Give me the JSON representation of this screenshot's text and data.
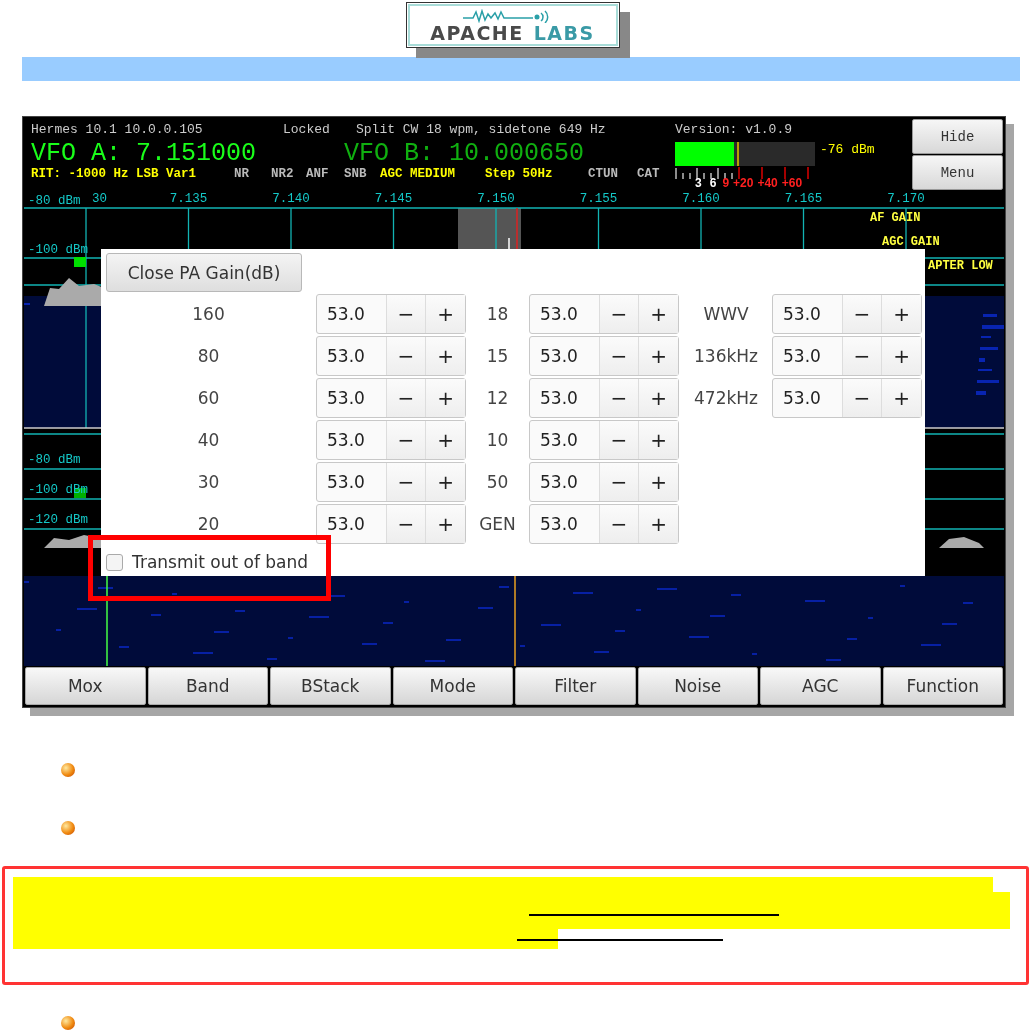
{
  "logo": {
    "word_1": "APACHE",
    "word_2": "LABS"
  },
  "app": {
    "info_line": [
      "Hermes 10.1 10.0.0.105",
      "Locked",
      "Split CW 18 wpm, sidetone 649 Hz",
      "Version: v1.0.9"
    ],
    "vfo_a": "VFO A: 7.151000",
    "vfo_b": "VFO B: 10.000650",
    "meter": {
      "level": 0.42,
      "reading": "-76 dBm",
      "scale": [
        {
          "text": "3",
          "over": false
        },
        {
          "text": "6",
          "over": false
        },
        {
          "text": "9",
          "over": true
        },
        {
          "text": "+20",
          "over": true
        },
        {
          "text": "+40",
          "over": true
        },
        {
          "text": "+60",
          "over": true
        }
      ]
    },
    "status_flags": [
      {
        "text": "RIT: -1000 Hz LSB Var1",
        "on": true
      },
      {
        "text": "NR",
        "on": false
      },
      {
        "text": "NR2",
        "on": false
      },
      {
        "text": "ANF",
        "on": false
      },
      {
        "text": "SNB",
        "on": false
      },
      {
        "text": "AGC MEDIUM",
        "on": true
      },
      {
        "text": "Step 50Hz",
        "on": true
      },
      {
        "text": "CTUN",
        "on": false
      },
      {
        "text": "CAT",
        "on": false
      }
    ],
    "side_buttons": [
      "Hide",
      "Menu"
    ],
    "spectrum": {
      "frequencies": [
        "30",
        "7.135",
        "7.140",
        "7.145",
        "7.150",
        "7.155",
        "7.160",
        "7.165",
        "7.170"
      ],
      "levels": [
        "-80 dBm",
        "-100 dBm"
      ],
      "gain_labels": [
        "AF GAIN",
        "AGC GAIN",
        "APTER LOW"
      ]
    },
    "spectrum_2": {
      "levels": [
        "-80 dBm",
        "-100 dBm",
        "-120 dBm"
      ]
    },
    "dialog": {
      "close_button": "Close PA Gain(dB)",
      "columns": [
        [
          {
            "band": "160",
            "value": "53.0"
          },
          {
            "band": "80",
            "value": "53.0"
          },
          {
            "band": "60",
            "value": "53.0"
          },
          {
            "band": "40",
            "value": "53.0"
          },
          {
            "band": "30",
            "value": "53.0"
          },
          {
            "band": "20",
            "value": "53.0"
          }
        ],
        [
          {
            "band": "18",
            "value": "53.0"
          },
          {
            "band": "15",
            "value": "53.0"
          },
          {
            "band": "12",
            "value": "53.0"
          },
          {
            "band": "10",
            "value": "53.0"
          },
          {
            "band": "50",
            "value": "53.0"
          },
          {
            "band": "GEN",
            "value": "53.0"
          }
        ],
        [
          {
            "band": "WWV",
            "value": "53.0"
          },
          {
            "band": "136kHz",
            "value": "53.0"
          },
          {
            "band": "472kHz",
            "value": "53.0"
          }
        ]
      ],
      "minus": "−",
      "plus": "+",
      "checkbox": {
        "label": "Transmit out of band",
        "checked": false
      }
    },
    "bottom_buttons": [
      "Mox",
      "Band",
      "BStack",
      "Mode",
      "Filter",
      "Noise",
      "AGC",
      "Function"
    ]
  }
}
